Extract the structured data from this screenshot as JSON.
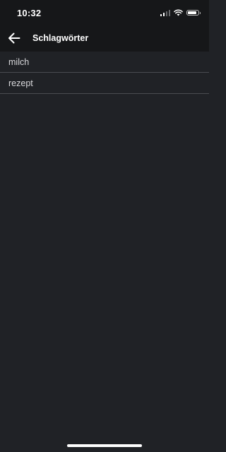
{
  "status_bar": {
    "time": "10:32",
    "icons": [
      "cellular-signal-icon",
      "wifi-icon",
      "battery-icon"
    ]
  },
  "app_bar": {
    "back_icon": "arrow-left-icon",
    "title": "Schlagwörter"
  },
  "tags": [
    {
      "label": "milch"
    },
    {
      "label": "rezept"
    }
  ],
  "colors": {
    "background": "#202226",
    "bar_background": "#161719",
    "text_primary": "#ffffff",
    "text_secondary": "#d9d9dc",
    "divider": "#4a4c51"
  }
}
